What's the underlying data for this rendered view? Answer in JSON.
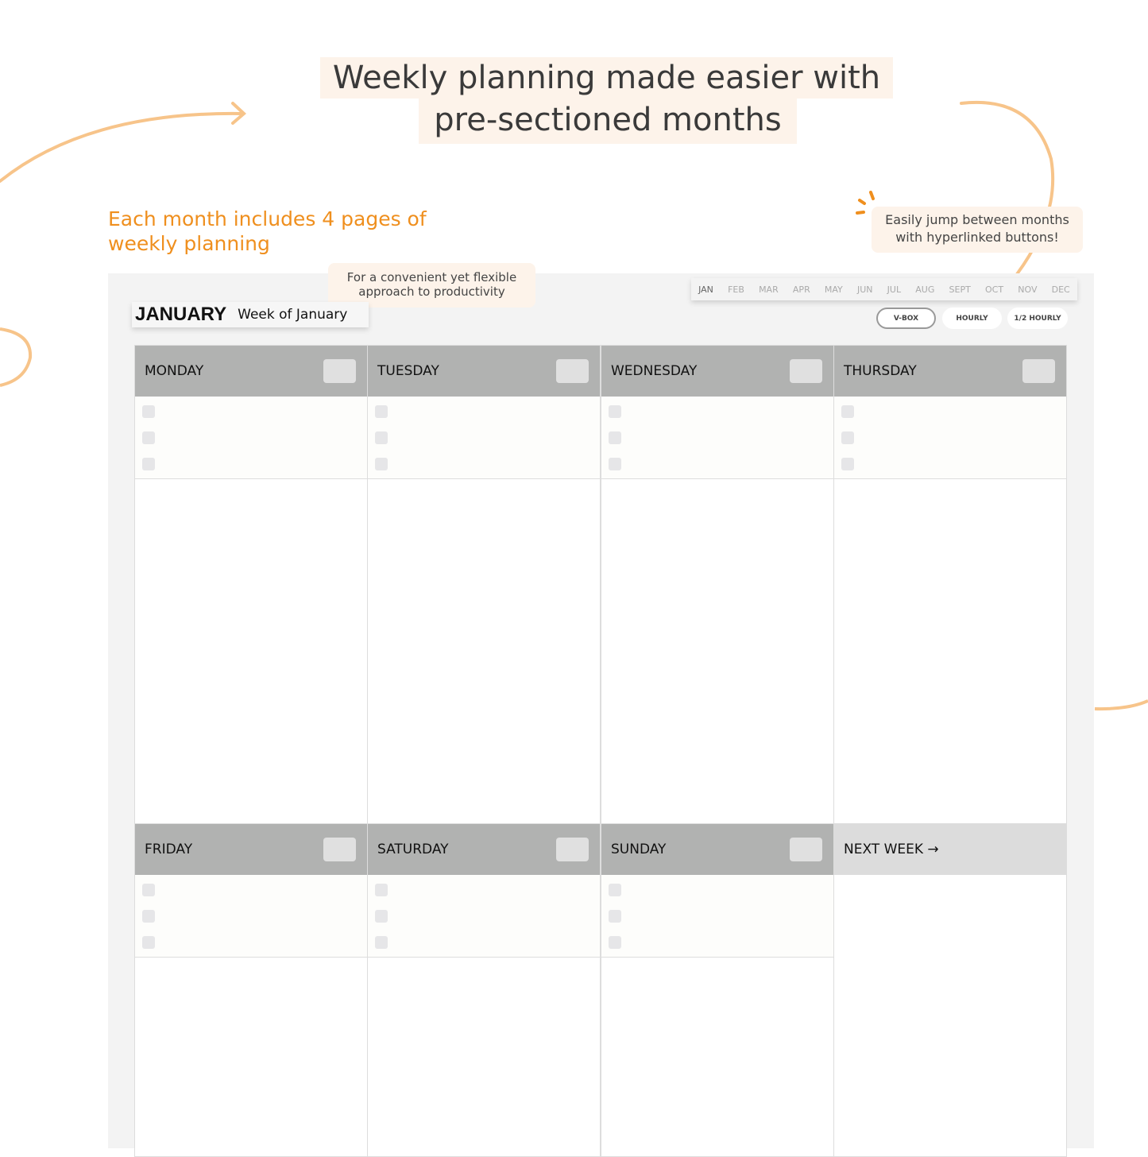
{
  "headline": {
    "line1": "Weekly planning made easier with",
    "line2": "pre-sectioned months"
  },
  "subheading": "Each month includes 4 pages of weekly planning",
  "note_flexible": "For a convenient yet flexible approach to productivity",
  "note_hyperlinks": "Easily jump between months with hyperlinked buttons!",
  "planner": {
    "month_title": "JANUARY",
    "week_label": "Week of January",
    "months": [
      "JAN",
      "FEB",
      "MAR",
      "APR",
      "MAY",
      "JUN",
      "JUL",
      "AUG",
      "SEPT",
      "OCT",
      "NOV",
      "DEC"
    ],
    "active_month": "JAN",
    "views": [
      "V-BOX",
      "HOURLY",
      "1/2 HOURLY"
    ],
    "active_view": "V-BOX",
    "days": [
      "MONDAY",
      "TUESDAY",
      "WEDNESDAY",
      "THURSDAY",
      "FRIDAY",
      "SATURDAY",
      "SUNDAY"
    ],
    "next_week": "NEXT WEEK →"
  },
  "colors": {
    "accent": "#ef8f1e",
    "curve": "#f7c48a",
    "note_bg": "#fdf3ea",
    "header_gray": "#b1b2b1"
  }
}
